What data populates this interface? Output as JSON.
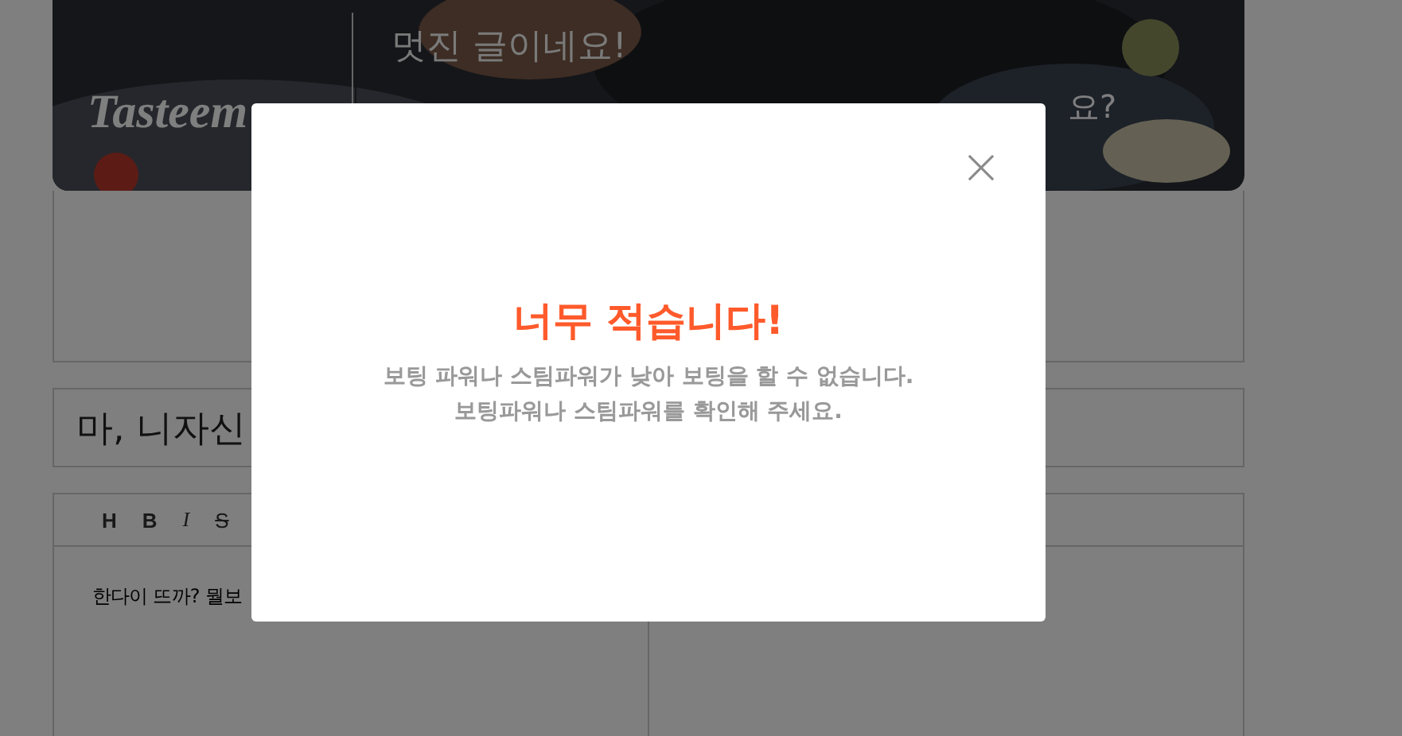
{
  "banner": {
    "logo": "Tasteem",
    "headline": "멋진 글이네요!",
    "subline": "요?"
  },
  "post": {
    "title": "마, 니자신",
    "toolbar": [
      {
        "label": "H",
        "kind": "heading"
      },
      {
        "label": "B",
        "kind": "bold"
      },
      {
        "label": "I",
        "kind": "italic"
      },
      {
        "label": "S",
        "kind": "strike"
      }
    ],
    "body": "한다이 뜨까? 뭘보"
  },
  "modal": {
    "title": "너무 적습니다!",
    "message_lines": [
      "보팅 파워나 스팀파워가 낮아 보팅을 할 수 없습니다.",
      "보팅파워나 스팀파워를 확인해 주세요."
    ]
  }
}
